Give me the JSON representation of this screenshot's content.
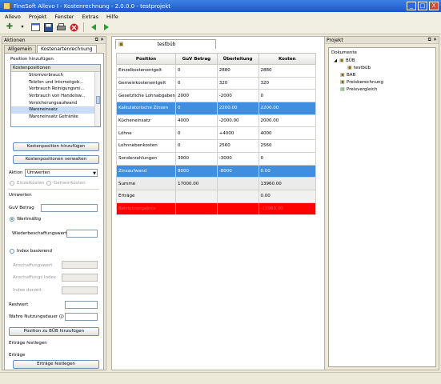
{
  "window": {
    "title": "FineSoft Allevo I - Kostenrechnung - 2.0.0.0 - testprojekt",
    "buttons": [
      "_",
      "□",
      "X"
    ]
  },
  "menu": [
    "Allevo",
    "Projekt",
    "Fenster",
    "Extras",
    "Hilfe"
  ],
  "left": {
    "title": "Aktionen",
    "tabs": [
      "Allgemein",
      "Kostenartenrechnung"
    ],
    "pos_label": "Position hinzufügen",
    "list_header": "Kostenpositionen",
    "list_items": [
      "Stromverbrauch",
      "Telefon und Internetgeb...",
      "Verbrauch Reinigungsmi...",
      "Verbrauch von Handelsw...",
      "Versicherungsaufwand",
      "Wareneinsatz",
      "Wareneinsatz Getränke"
    ],
    "btn_add": "Kostenposition hinzufügen",
    "btn_manage": "Kostenpositionen verwalten",
    "aktion_label": "Aktion",
    "aktion_value": "Umwerten",
    "radio_einzel": "Einzelkosten",
    "radio_gemein": "Gemeinkosten",
    "umwerten": "Umwerten",
    "guv_betrag": "GuV Betrag",
    "wertmaessig": "Wertmäßig",
    "wiederbeschaffung": "Wiederbeschaffungswert",
    "index_basierend": "Index basierend",
    "anschaffungswert": "Anschaffungswert",
    "anschaffungs_index": "Anschaffungs Index",
    "index_derzeit": "Index derzeit",
    "restwert": "Restwert",
    "nutzungsdauer": "Wahre Nutzungsdauer (J)",
    "btn_pos_bub": "Position zu BÜB hinzufügen",
    "ertraege_fest": "Erträge festlegen",
    "ertraege": "Erträge",
    "btn_ertraege": "Erträge festlegen"
  },
  "center": {
    "tab": "testbüb",
    "columns": [
      "Position",
      "GuV Betrag",
      "Überleitung",
      "Kosten"
    ],
    "rows": [
      {
        "c": [
          "Einzelkostenentgelt",
          "0",
          "2880",
          "2880"
        ],
        "style": ""
      },
      {
        "c": [
          "Gemeinkostenentgelt",
          "0",
          "320",
          "320"
        ],
        "style": ""
      },
      {
        "c": [
          "Gesetzliche Lohnabgaben",
          "2000",
          "-2000",
          "0"
        ],
        "style": ""
      },
      {
        "c": [
          "Kalkulatorische Zinsen",
          "0",
          "2200.00",
          "2200.00"
        ],
        "style": "blue"
      },
      {
        "c": [
          "Kücheneinsatz",
          "4000",
          "-2000.00",
          "2000.00"
        ],
        "style": ""
      },
      {
        "c": [
          "Löhne",
          "0",
          "+4000",
          "4000"
        ],
        "style": ""
      },
      {
        "c": [
          "Lohnnebenkosten",
          "0",
          "2560",
          "2560"
        ],
        "style": ""
      },
      {
        "c": [
          "Sonderzahlungen",
          "3000",
          "-3000",
          "0"
        ],
        "style": ""
      },
      {
        "c": [
          "Zinsaufwand",
          "8000",
          "-8000",
          "0.00"
        ],
        "style": "blue"
      },
      {
        "c": [
          "Summe",
          "17000.00",
          "",
          "13960.00"
        ],
        "style": "sum"
      },
      {
        "c": [
          "Erträge",
          "",
          "",
          "0.00"
        ],
        "style": "gray"
      },
      {
        "c": [
          "Betriebsergebnis",
          "",
          "",
          "-13960.00"
        ],
        "style": "red"
      }
    ]
  },
  "right": {
    "title": "Projekt",
    "tree_root": "Dokumente",
    "nodes": [
      "BÜB",
      "testbüb",
      "BAB",
      "Preisberechnung",
      "Preisvergleich"
    ]
  }
}
